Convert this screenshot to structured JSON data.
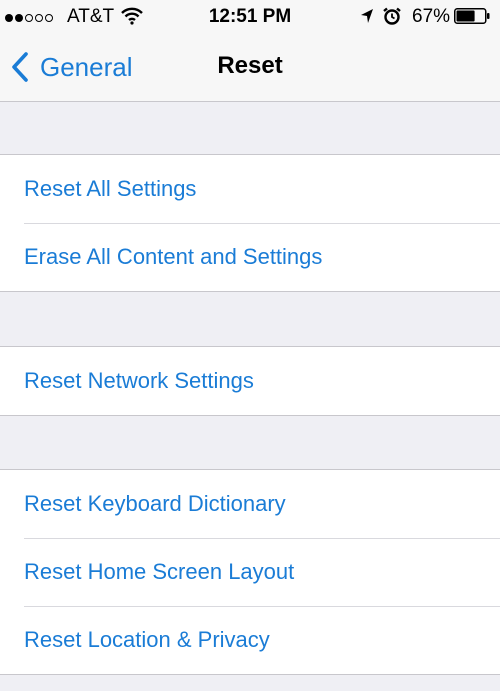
{
  "status_bar": {
    "signal_full": 2,
    "signal_empty": 3,
    "carrier": "AT&T",
    "time": "12:51 PM",
    "battery_percent": "67%",
    "battery_level": 0.67,
    "icons": [
      "wifi-icon",
      "location-arrow-icon",
      "alarm-clock-icon",
      "battery-icon"
    ]
  },
  "nav": {
    "back_label": "General",
    "title": "Reset"
  },
  "groups": [
    [
      "Reset All Settings",
      "Erase All Content and Settings"
    ],
    [
      "Reset Network Settings"
    ],
    [
      "Reset Keyboard Dictionary",
      "Reset Home Screen Layout",
      "Reset Location & Privacy"
    ]
  ],
  "colors": {
    "accent": "#1a7cd6",
    "background": "#efeff4",
    "bar": "#f7f7f7"
  }
}
